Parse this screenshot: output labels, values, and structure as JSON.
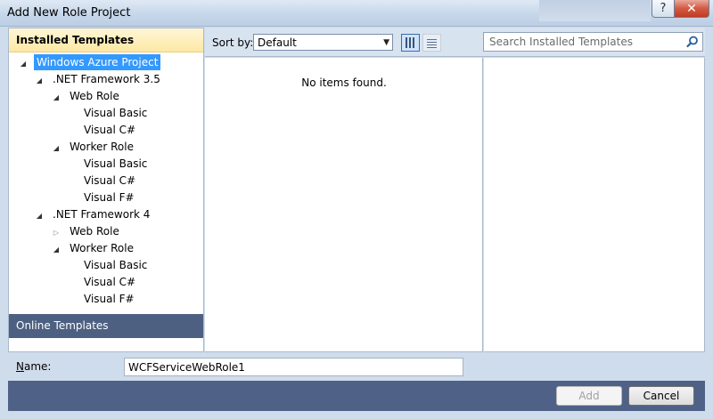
{
  "window": {
    "title": "Add New Role Project",
    "help_glyph": "?",
    "close_glyph": "✕"
  },
  "left": {
    "installed_header": "Installed Templates",
    "online_header": "Online Templates",
    "tree": [
      {
        "label": "Windows Azure Project",
        "arrow": "◢",
        "selected": true
      },
      {
        "label": ".NET Framework 3.5",
        "arrow": "◢"
      },
      {
        "label": "Web Role",
        "arrow": "◢"
      },
      {
        "label": "Visual Basic",
        "arrow": ""
      },
      {
        "label": "Visual C#",
        "arrow": ""
      },
      {
        "label": "Worker Role",
        "arrow": "◢"
      },
      {
        "label": "Visual Basic",
        "arrow": ""
      },
      {
        "label": "Visual C#",
        "arrow": ""
      },
      {
        "label": "Visual F#",
        "arrow": ""
      },
      {
        "label": ".NET Framework 4",
        "arrow": "◢"
      },
      {
        "label": "Web Role",
        "arrow": "▷"
      },
      {
        "label": "Worker Role",
        "arrow": "◢"
      },
      {
        "label": "Visual Basic",
        "arrow": ""
      },
      {
        "label": "Visual C#",
        "arrow": ""
      },
      {
        "label": "Visual F#",
        "arrow": ""
      }
    ]
  },
  "toolbar": {
    "sort_label": "Sort by:",
    "sort_value": "Default",
    "search_placeholder": "Search Installed Templates"
  },
  "main": {
    "empty_message": "No items found."
  },
  "form": {
    "name_label_prefix": "N",
    "name_label_rest": "ame:",
    "name_value": "WCFServiceWebRole1"
  },
  "buttons": {
    "add": "Add",
    "cancel": "Cancel"
  },
  "colors": {
    "selected": "#3399ff",
    "footer": "#4f6186",
    "online_header": "#4d6082"
  }
}
